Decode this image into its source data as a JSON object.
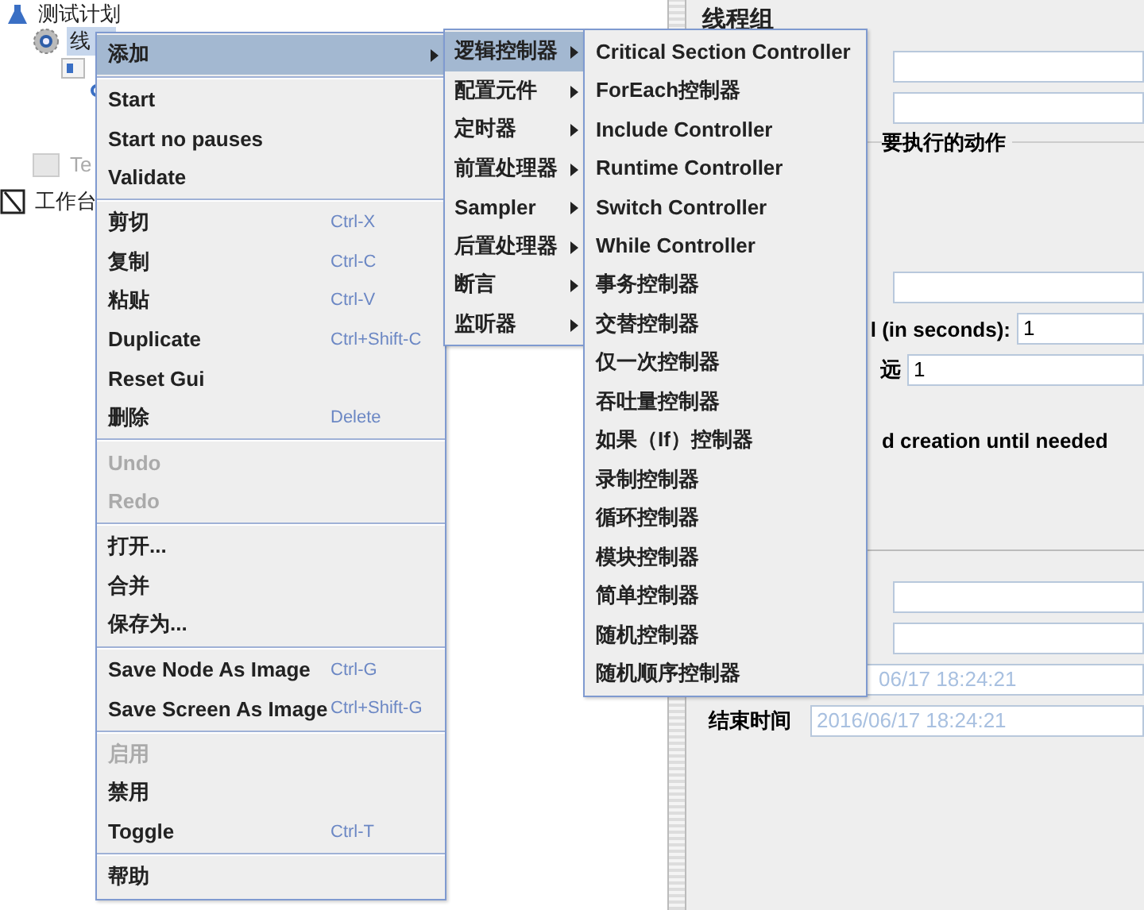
{
  "tree": [
    {
      "label": "测试计划",
      "kind": "plan",
      "selected": false,
      "disabled": false
    },
    {
      "label": "线",
      "kind": "group",
      "selected": true,
      "disabled": false
    },
    {
      "kind": "controller"
    },
    {
      "kind": "sampler"
    },
    {
      "label": "Te",
      "kind": "fragment",
      "selected": false,
      "disabled": true
    },
    {
      "label": "工作台",
      "kind": "workbench",
      "selected": false,
      "disabled": false
    }
  ],
  "panel": {
    "title": "线程组",
    "section_label": "要执行的动作",
    "rows": [
      {
        "kind": "field"
      },
      {
        "kind": "field"
      },
      {
        "kind": "section"
      },
      {
        "kind": "field"
      },
      {
        "kind": "labeled",
        "label": "l (in seconds):",
        "value": "1"
      },
      {
        "kind": "labeled",
        "label": "远",
        "value": "1"
      },
      {
        "kind": "text",
        "label": "d creation until needed"
      },
      {
        "kind": "rule"
      },
      {
        "kind": "field"
      },
      {
        "kind": "field"
      },
      {
        "kind": "date",
        "label": "",
        "value": "06/17 18:24:21"
      },
      {
        "kind": "date",
        "label": "结束时间",
        "value": "2016/06/17 18:24:21"
      }
    ]
  },
  "context_menu": [
    {
      "kind": "item",
      "label": "添加",
      "submenu": true,
      "selected": true,
      "disabled": false
    },
    {
      "kind": "separator"
    },
    {
      "kind": "item",
      "label": "Start",
      "selected": false,
      "disabled": false
    },
    {
      "kind": "item",
      "label": "Start no pauses",
      "selected": false,
      "disabled": false
    },
    {
      "kind": "item",
      "label": "Validate",
      "selected": false,
      "disabled": false
    },
    {
      "kind": "separator"
    },
    {
      "kind": "item",
      "label": "剪切",
      "shortcut": "Ctrl-X",
      "selected": false,
      "disabled": false
    },
    {
      "kind": "item",
      "label": "复制",
      "shortcut": "Ctrl-C",
      "selected": false,
      "disabled": false
    },
    {
      "kind": "item",
      "label": "粘贴",
      "shortcut": "Ctrl-V",
      "selected": false,
      "disabled": false
    },
    {
      "kind": "item",
      "label": "Duplicate",
      "shortcut": "Ctrl+Shift-C",
      "selected": false,
      "disabled": false
    },
    {
      "kind": "item",
      "label": "Reset Gui",
      "selected": false,
      "disabled": false
    },
    {
      "kind": "item",
      "label": "删除",
      "shortcut": "Delete",
      "selected": false,
      "disabled": false
    },
    {
      "kind": "separator"
    },
    {
      "kind": "item",
      "label": "Undo",
      "selected": false,
      "disabled": true
    },
    {
      "kind": "item",
      "label": "Redo",
      "selected": false,
      "disabled": true
    },
    {
      "kind": "separator"
    },
    {
      "kind": "item",
      "label": "打开...",
      "selected": false,
      "disabled": false
    },
    {
      "kind": "item",
      "label": "合并",
      "selected": false,
      "disabled": false
    },
    {
      "kind": "item",
      "label": "保存为...",
      "selected": false,
      "disabled": false
    },
    {
      "kind": "separator"
    },
    {
      "kind": "item",
      "label": "Save Node As Image",
      "shortcut": "Ctrl-G",
      "selected": false,
      "disabled": false
    },
    {
      "kind": "item",
      "label": "Save Screen As Image",
      "shortcut": "Ctrl+Shift-G",
      "selected": false,
      "disabled": false
    },
    {
      "kind": "separator"
    },
    {
      "kind": "item",
      "label": "启用",
      "selected": false,
      "disabled": true
    },
    {
      "kind": "item",
      "label": "禁用",
      "selected": false,
      "disabled": false
    },
    {
      "kind": "item",
      "label": "Toggle",
      "shortcut": "Ctrl-T",
      "selected": false,
      "disabled": false
    },
    {
      "kind": "separator"
    },
    {
      "kind": "item",
      "label": "帮助",
      "selected": false,
      "disabled": false
    }
  ],
  "add_submenu": [
    {
      "kind": "item",
      "label": "逻辑控制器",
      "submenu": true,
      "selected": true,
      "disabled": false
    },
    {
      "kind": "item",
      "label": "配置元件",
      "submenu": true,
      "selected": false,
      "disabled": false
    },
    {
      "kind": "item",
      "label": "定时器",
      "submenu": true,
      "selected": false,
      "disabled": false
    },
    {
      "kind": "item",
      "label": "前置处理器",
      "submenu": true,
      "selected": false,
      "disabled": false
    },
    {
      "kind": "item",
      "label": "Sampler",
      "submenu": true,
      "selected": false,
      "disabled": false
    },
    {
      "kind": "item",
      "label": "后置处理器",
      "submenu": true,
      "selected": false,
      "disabled": false
    },
    {
      "kind": "item",
      "label": "断言",
      "submenu": true,
      "selected": false,
      "disabled": false
    },
    {
      "kind": "item",
      "label": "监听器",
      "submenu": true,
      "selected": false,
      "disabled": false
    }
  ],
  "controller_submenu": [
    {
      "kind": "item",
      "label": "Critical Section Controller",
      "selected": false,
      "disabled": false
    },
    {
      "kind": "item",
      "label": "ForEach控制器",
      "selected": false,
      "disabled": false
    },
    {
      "kind": "item",
      "label": "Include Controller",
      "selected": false,
      "disabled": false
    },
    {
      "kind": "item",
      "label": "Runtime Controller",
      "selected": false,
      "disabled": false
    },
    {
      "kind": "item",
      "label": "Switch Controller",
      "selected": false,
      "disabled": false
    },
    {
      "kind": "item",
      "label": "While Controller",
      "selected": false,
      "disabled": false
    },
    {
      "kind": "item",
      "label": "事务控制器",
      "selected": false,
      "disabled": false
    },
    {
      "kind": "item",
      "label": "交替控制器",
      "selected": false,
      "disabled": false
    },
    {
      "kind": "item",
      "label": "仅一次控制器",
      "selected": false,
      "disabled": false
    },
    {
      "kind": "item",
      "label": "吞吐量控制器",
      "selected": false,
      "disabled": false
    },
    {
      "kind": "item",
      "label": "如果（If）控制器",
      "selected": false,
      "disabled": false
    },
    {
      "kind": "item",
      "label": "录制控制器",
      "selected": false,
      "disabled": false
    },
    {
      "kind": "item",
      "label": "循环控制器",
      "selected": false,
      "disabled": false
    },
    {
      "kind": "item",
      "label": "模块控制器",
      "selected": false,
      "disabled": false
    },
    {
      "kind": "item",
      "label": "简单控制器",
      "selected": false,
      "disabled": false
    },
    {
      "kind": "item",
      "label": "随机控制器",
      "selected": false,
      "disabled": false
    },
    {
      "kind": "item",
      "label": "随机顺序控制器",
      "selected": false,
      "disabled": false
    }
  ]
}
